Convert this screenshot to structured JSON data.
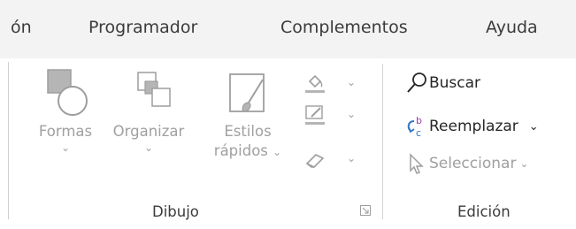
{
  "tabs": [
    {
      "label": "ón"
    },
    {
      "label": "Programador"
    },
    {
      "label": "Complementos"
    },
    {
      "label": "Ayuda"
    }
  ],
  "dibujo": {
    "group_label": "Dibujo",
    "formas": {
      "label": "Formas",
      "icon": "shapes-icon"
    },
    "organizar": {
      "label": "Organizar",
      "icon": "arrange-icon"
    },
    "estilos": {
      "label_line1": "Estilos",
      "label_line2": "rápidos",
      "icon": "quick-styles-icon"
    },
    "small_tools": [
      {
        "name": "shape-fill",
        "icon": "paint-bucket-icon"
      },
      {
        "name": "shape-outline",
        "icon": "pen-outline-icon"
      },
      {
        "name": "shape-effects",
        "icon": "eraser-effects-icon"
      }
    ]
  },
  "edicion": {
    "group_label": "Edición",
    "buscar": {
      "label": "Buscar",
      "icon": "search-icon"
    },
    "reemplazar": {
      "label": "Reemplazar",
      "icon": "replace-icon"
    },
    "seleccionar": {
      "label": "Seleccionar",
      "icon": "cursor-select-icon"
    }
  },
  "colors": {
    "tab_bar_bg": "#f3f3f3",
    "text": "#3b3b3b",
    "disabled": "#a0a0a0",
    "replace_accent_blue": "#2f74c7",
    "replace_accent_purple": "#9b3fa8"
  }
}
